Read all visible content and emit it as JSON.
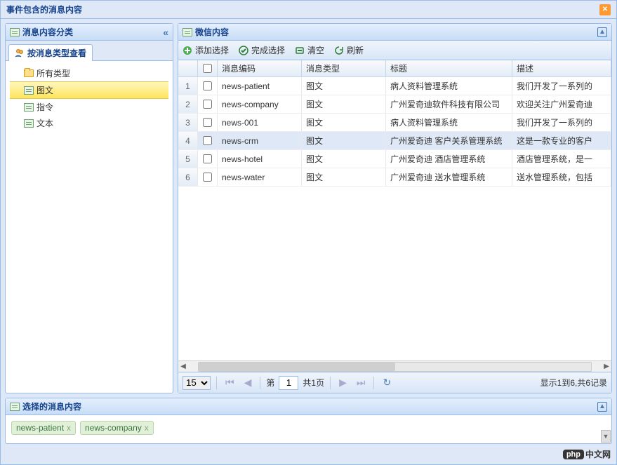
{
  "window": {
    "title": "事件包含的消息内容"
  },
  "left": {
    "title": "消息内容分类",
    "tab": {
      "label": "按消息类型查看"
    },
    "tree": [
      {
        "label": "所有类型",
        "selected": false
      },
      {
        "label": "图文",
        "selected": true
      },
      {
        "label": "指令",
        "selected": false
      },
      {
        "label": "文本",
        "selected": false
      }
    ]
  },
  "right": {
    "title": "微信内容",
    "toolbar": {
      "add": "添加选择",
      "finish": "完成选择",
      "clear": "清空",
      "refresh": "刷新"
    },
    "columns": {
      "code": "消息编码",
      "type": "消息类型",
      "title": "标题",
      "desc": "描述"
    },
    "rows": [
      {
        "num": "1",
        "code": "news-patient",
        "type": "图文",
        "title": "病人资料管理系统",
        "desc": "我们开发了一系列的"
      },
      {
        "num": "2",
        "code": "news-company",
        "type": "图文",
        "title": "广州爱奇迪软件科技有限公司",
        "desc": "欢迎关注广州爱奇迪"
      },
      {
        "num": "3",
        "code": "news-001",
        "type": "图文",
        "title": "病人资料管理系统",
        "desc": "我们开发了一系列的"
      },
      {
        "num": "4",
        "code": "news-crm",
        "type": "图文",
        "title": "广州爱奇迪 客户关系管理系统",
        "desc": "这是一款专业的客户"
      },
      {
        "num": "5",
        "code": "news-hotel",
        "type": "图文",
        "title": "广州爱奇迪 酒店管理系统",
        "desc": "酒店管理系统，是一"
      },
      {
        "num": "6",
        "code": "news-water",
        "type": "图文",
        "title": "广州爱奇迪 送水管理系统",
        "desc": "送水管理系统，包括"
      }
    ],
    "pager": {
      "page_size": "15",
      "page_label_prefix": "第",
      "page_current": "1",
      "page_label_suffix": "共1页",
      "summary": "显示1到6,共6记录"
    }
  },
  "bottom": {
    "title": "选择的消息内容",
    "tags": [
      {
        "label": "news-patient"
      },
      {
        "label": "news-company"
      }
    ]
  },
  "logo": {
    "brand": "php",
    "text": "中文网"
  }
}
